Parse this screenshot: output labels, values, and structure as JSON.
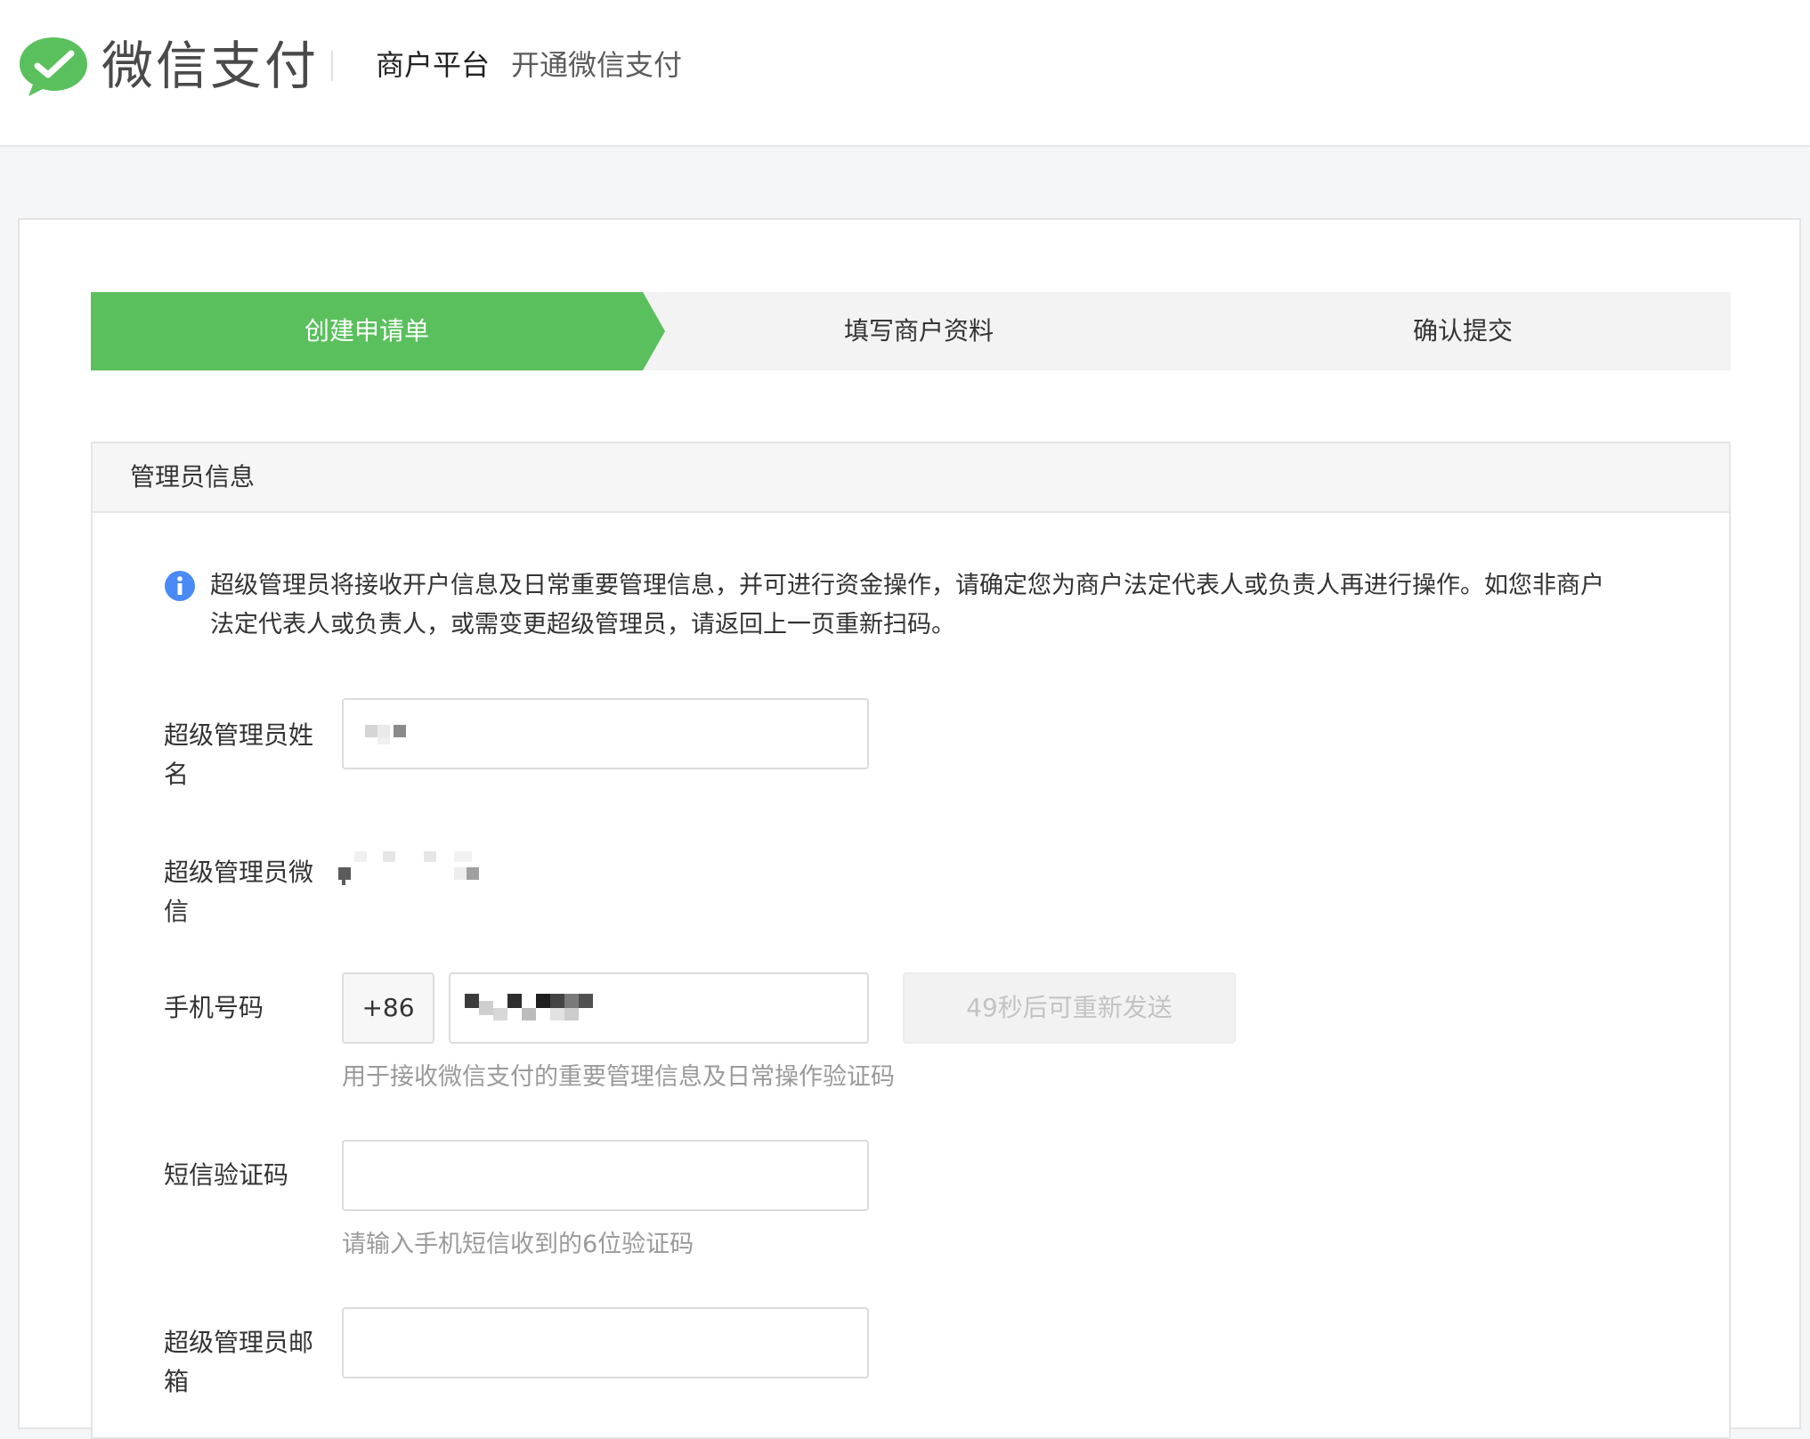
{
  "header": {
    "logo_text": "微信支付",
    "platform_name": "商户平台",
    "subtitle": "开通微信支付"
  },
  "steps": [
    {
      "label": "创建申请单",
      "active": true
    },
    {
      "label": "填写商户资料",
      "active": false
    },
    {
      "label": "确认提交",
      "active": false
    }
  ],
  "section": {
    "title": "管理员信息",
    "notice_line1": "超级管理员将接收开户信息及日常重要管理信息，并可进行资金操作，请确定您为商户法定代表人或负责人再进行操作。如您非商户",
    "notice_line2": "法定代表人或负责人，或需变更超级管理员，请返回上一页重新扫码。"
  },
  "form": {
    "name_label_line1": "超级管理员姓",
    "name_label_line2": "名",
    "wechat_label_line1": "超级管理员微",
    "wechat_label_line2": "信",
    "phone_label": "手机号码",
    "country_code": "+86",
    "resend_label": "49秒后可重新发送",
    "phone_hint": "用于接收微信支付的重要管理信息及日常操作验证码",
    "sms_label": "短信验证码",
    "sms_hint": "请输入手机短信收到的6位验证码",
    "email_label_line1": "超级管理员邮",
    "email_label_line2": "箱"
  },
  "colors": {
    "accent": "#5ac05d",
    "info": "#4a8af4"
  }
}
